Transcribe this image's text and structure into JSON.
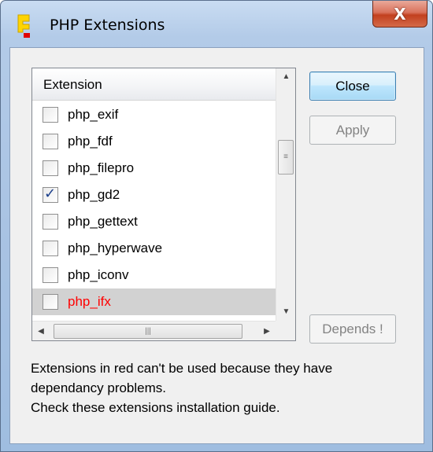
{
  "window": {
    "title": "PHP Extensions",
    "close_glyph": "X"
  },
  "list": {
    "header": "Extension",
    "items": [
      {
        "label": "php_exif",
        "checked": false,
        "red": false
      },
      {
        "label": "php_fdf",
        "checked": false,
        "red": false
      },
      {
        "label": "php_filepro",
        "checked": false,
        "red": false
      },
      {
        "label": "php_gd2",
        "checked": true,
        "red": false
      },
      {
        "label": "php_gettext",
        "checked": false,
        "red": false
      },
      {
        "label": "php_hyperwave",
        "checked": false,
        "red": false
      },
      {
        "label": "php_iconv",
        "checked": false,
        "red": false
      },
      {
        "label": "php_ifx",
        "checked": false,
        "red": true,
        "selected": true
      }
    ]
  },
  "buttons": {
    "close": "Close",
    "apply": "Apply",
    "depends": "Depends !"
  },
  "info": {
    "line1": "Extensions in red can't be used because they have",
    "line2": "dependancy problems.",
    "line3": "Check these extensions installation guide."
  },
  "colors": {
    "error_text": "#ff0000",
    "accent": "#3c7fb1"
  },
  "icons": {
    "window_close": "close-icon",
    "app": "easyphp-icon",
    "check": "checkmark-icon"
  }
}
